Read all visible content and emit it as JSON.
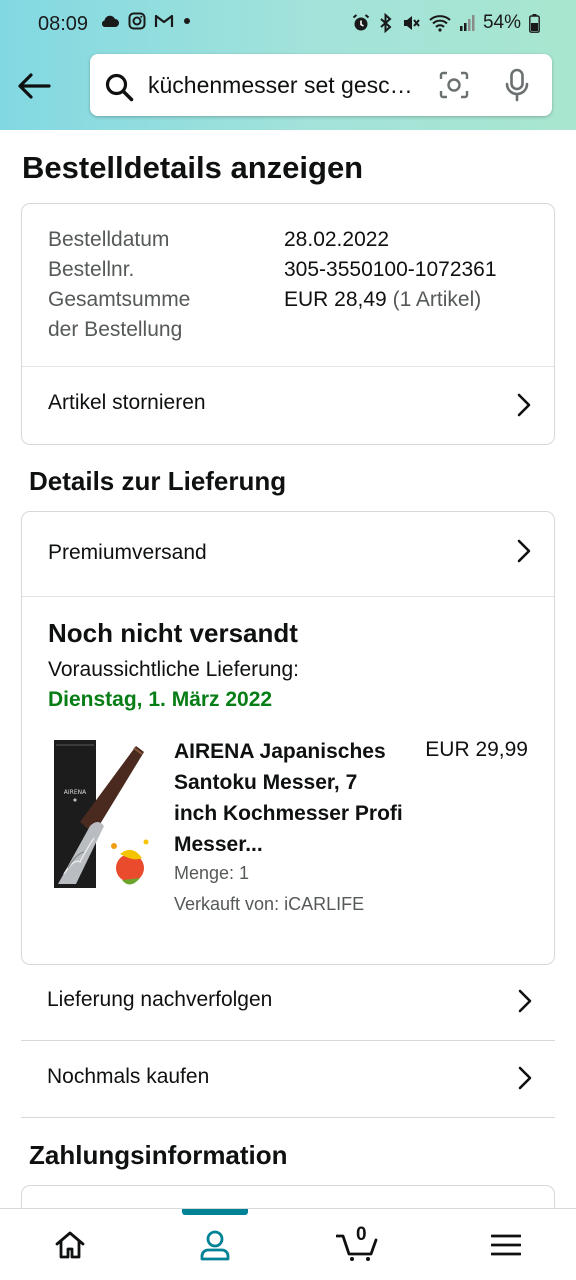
{
  "status_bar": {
    "time": "08:09",
    "battery": "54%"
  },
  "search": {
    "query": "küchenmesser set gesc…"
  },
  "page": {
    "title": "Bestelldetails anzeigen"
  },
  "order": {
    "date_label": "Bestelldatum",
    "date_value": "28.02.2022",
    "number_label": "Bestellnr.",
    "number_value": "305-3550100-1072361",
    "total_label_line1": "Gesamtsumme",
    "total_label_line2": "der Bestellung",
    "total_value": "EUR 28,49",
    "total_items": "(1 Artikel)",
    "cancel_label": "Artikel stornieren"
  },
  "delivery": {
    "section_title": "Details zur Lieferung",
    "shipping_method": "Premiumversand",
    "status": "Noch nicht versandt",
    "estimate_label": "Voraussichtliche Lieferung:",
    "estimate_date": "Dienstag, 1. März 2022",
    "product": {
      "title": "AIRENA Japanisches Santoku Messer, 7 inch Kochmesser Profi Messer...",
      "price": "EUR 29,99",
      "quantity": "Menge: 1",
      "seller": "Verkauft von: iCARLIFE",
      "image_brand_text": "AIRENA"
    },
    "track_label": "Lieferung nachverfolgen",
    "buy_again_label": "Nochmals kaufen"
  },
  "payment": {
    "section_title": "Zahlungsinformation"
  },
  "bottom_nav": {
    "cart_count": "0",
    "active": "account",
    "accent_color": "#008296"
  },
  "colors": {
    "delivery_green": "#067d15",
    "header_gradient_start": "#82d8e2",
    "header_gradient_end": "#a8e6cf"
  }
}
